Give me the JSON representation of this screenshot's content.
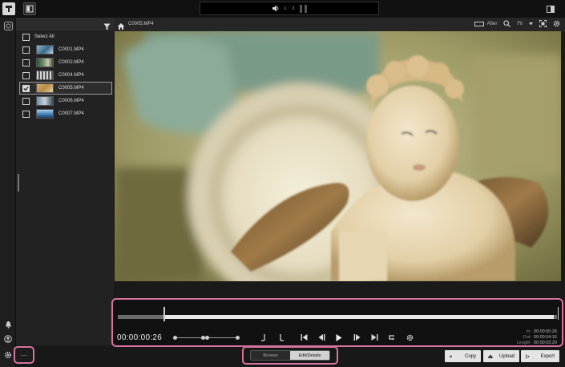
{
  "audio_meter": {
    "channels": "1  2"
  },
  "file_panel": {
    "select_all_label": "Select All",
    "files": [
      {
        "name": "C0001.MP4",
        "checked": false,
        "selected": false
      },
      {
        "name": "C0002.MP4",
        "checked": false,
        "selected": false
      },
      {
        "name": "C0004.MP4",
        "checked": false,
        "selected": false
      },
      {
        "name": "C0005.MP4",
        "checked": true,
        "selected": true
      },
      {
        "name": "C0006.MP4",
        "checked": false,
        "selected": false
      },
      {
        "name": "C0007.MP4",
        "checked": false,
        "selected": false
      }
    ]
  },
  "viewer": {
    "breadcrumb": "C0005.MP4",
    "compare_label": "After",
    "zoom_value": "Fit"
  },
  "timeline": {
    "timecode": "00:00:00:26",
    "playhead_fraction": 0.105,
    "in_label": "In:",
    "in_value": "00:00:00:26",
    "out_label": "Out:",
    "out_value": "00:00:04:16",
    "length_label": "Length:",
    "length_value": "00:00:03:20"
  },
  "bottom_bar": {
    "more_label": "···",
    "mode_browse": "Browse",
    "mode_edit": "Edit/Details",
    "active_mode": "Edit/Details",
    "copy_label": "Copy",
    "upload_label": "Upload",
    "export_label": "Export"
  },
  "colors": {
    "highlight": "#d7739e",
    "background": "#1a1a1a"
  },
  "icons": [
    "app-menu-icon",
    "panel-toggle-icon",
    "volume-icon",
    "right-panel-icon",
    "clip-rail-icon",
    "notification-icon",
    "account-icon",
    "settings-icon",
    "filter-icon",
    "home-icon",
    "magnifier-icon",
    "fullscreen-icon",
    "gear-icon",
    "mark-in-icon",
    "mark-out-icon",
    "go-to-start-icon",
    "step-back-icon",
    "play-icon",
    "step-forward-icon",
    "go-to-end-icon",
    "loop-icon",
    "copy-icon",
    "upload-icon",
    "export-icon"
  ]
}
